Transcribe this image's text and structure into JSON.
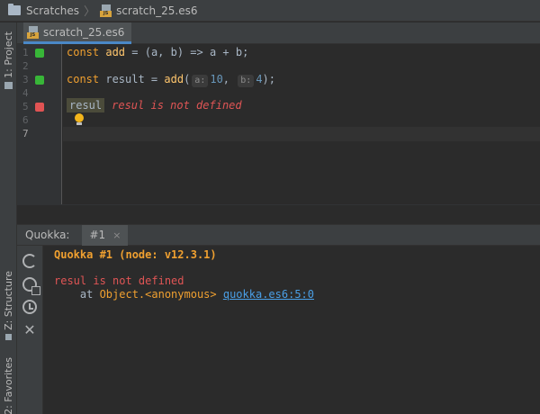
{
  "breadcrumb": {
    "root": "Scratches",
    "file": "scratch_25.es6"
  },
  "left_strip": {
    "project_tab": "1: Project",
    "structure_tab": "Z: Structure",
    "favorites_tab": "2: Favorites"
  },
  "editor": {
    "tab_label": "scratch_25.es6",
    "line_numbers": [
      "1",
      "2",
      "3",
      "4",
      "5",
      "6",
      "7"
    ],
    "line1": {
      "kw": "const",
      "name": "add",
      "rest": " = (a, b) => a + b;"
    },
    "line3": {
      "kw": "const",
      "name": " result = ",
      "fn": "add",
      "open": "(",
      "hint_a": "a:",
      "val_a": "10",
      "comma": ",",
      "hint_b": "b:",
      "val_b": "4",
      "close": ");"
    },
    "line5": {
      "token": "resul",
      "error": "resul is not defined"
    }
  },
  "quokka": {
    "panel_title": "Quokka:",
    "tab_label": "#1",
    "tab_close": "×",
    "header": "Quokka #1 (node: v12.3.1)",
    "error_message": "resul is not defined",
    "trace_at": "    at ",
    "trace_object": "Object.<anonymous>",
    "trace_link": "quokka.es6:5:0"
  },
  "icons": {
    "refresh": "refresh-icon",
    "sync": "sync-icon",
    "clock": "clock-icon",
    "close": "close-icon",
    "bulb": "lightbulb-icon"
  },
  "colors": {
    "keyword": "#f0a030",
    "error": "#e05555",
    "success_marker": "#38b638",
    "link": "#4a9fe6"
  }
}
